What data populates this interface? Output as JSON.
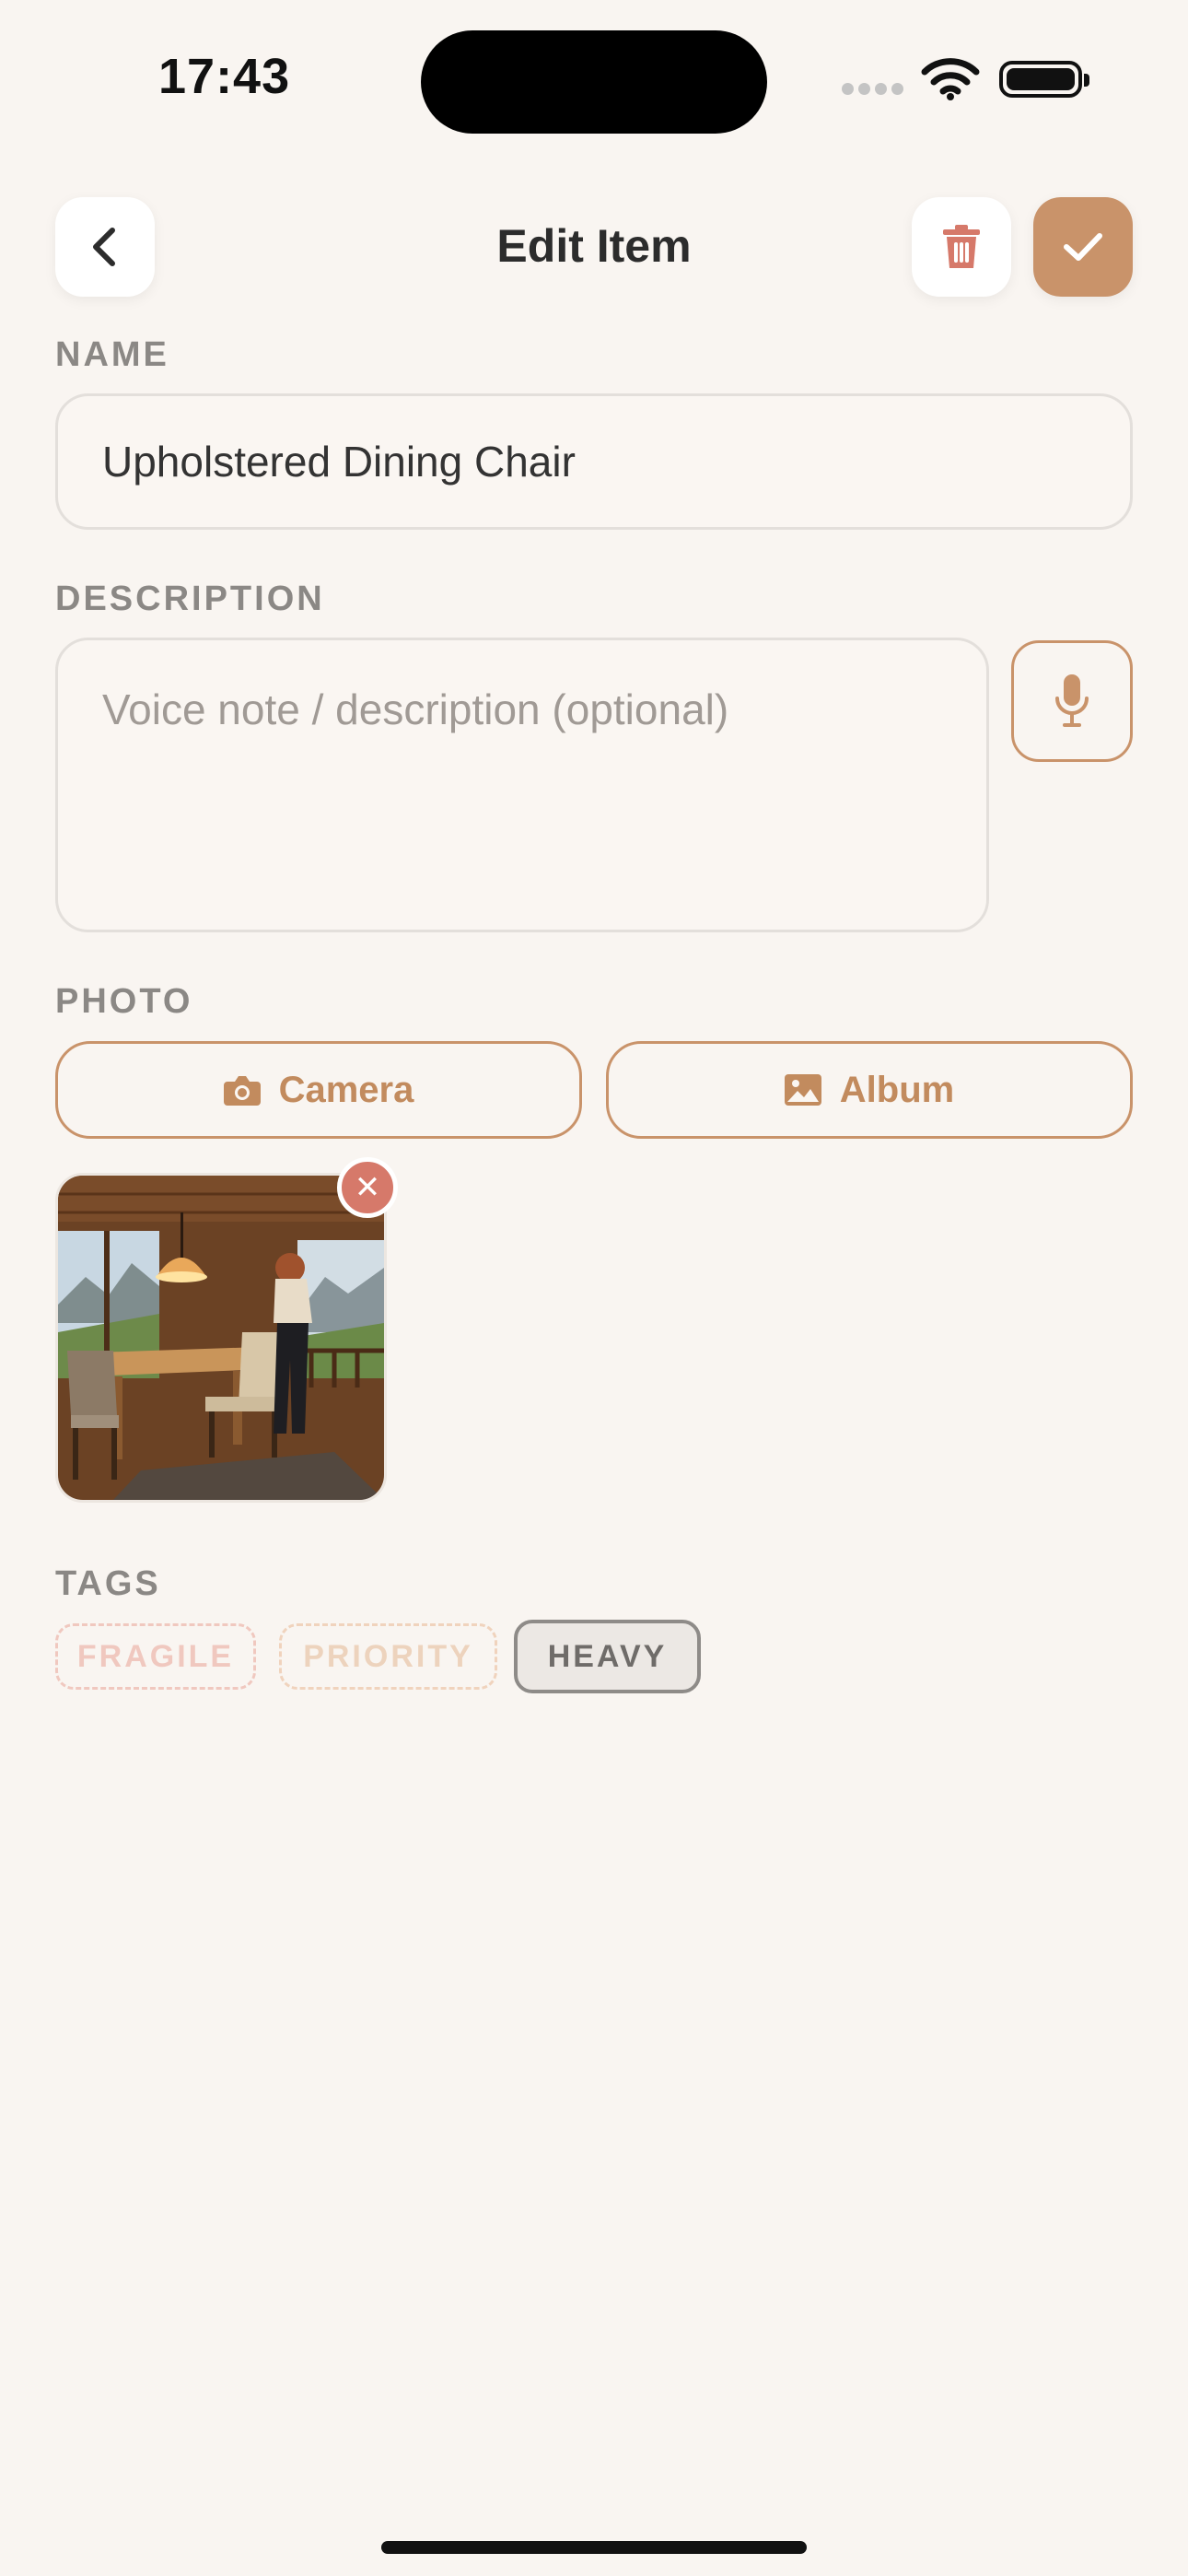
{
  "status_bar": {
    "time": "17:43"
  },
  "header": {
    "title": "Edit Item"
  },
  "name": {
    "label": "NAME",
    "value": "Upholstered Dining Chair"
  },
  "description": {
    "label": "DESCRIPTION",
    "placeholder": "Voice note / description (optional)"
  },
  "photo": {
    "label": "PHOTO",
    "camera_label": "Camera",
    "album_label": "Album"
  },
  "tags": {
    "label": "TAGS",
    "items": [
      {
        "label": "FRAGILE",
        "selected": false
      },
      {
        "label": "PRIORITY",
        "selected": false
      },
      {
        "label": "HEAVY",
        "selected": true
      }
    ]
  },
  "colors": {
    "accent": "#c9936a",
    "delete": "#d6796a",
    "background": "#f9f5f1"
  },
  "icons": [
    "back-icon",
    "trash-icon",
    "check-icon",
    "microphone-icon",
    "camera-icon",
    "image-icon",
    "close-icon"
  ]
}
